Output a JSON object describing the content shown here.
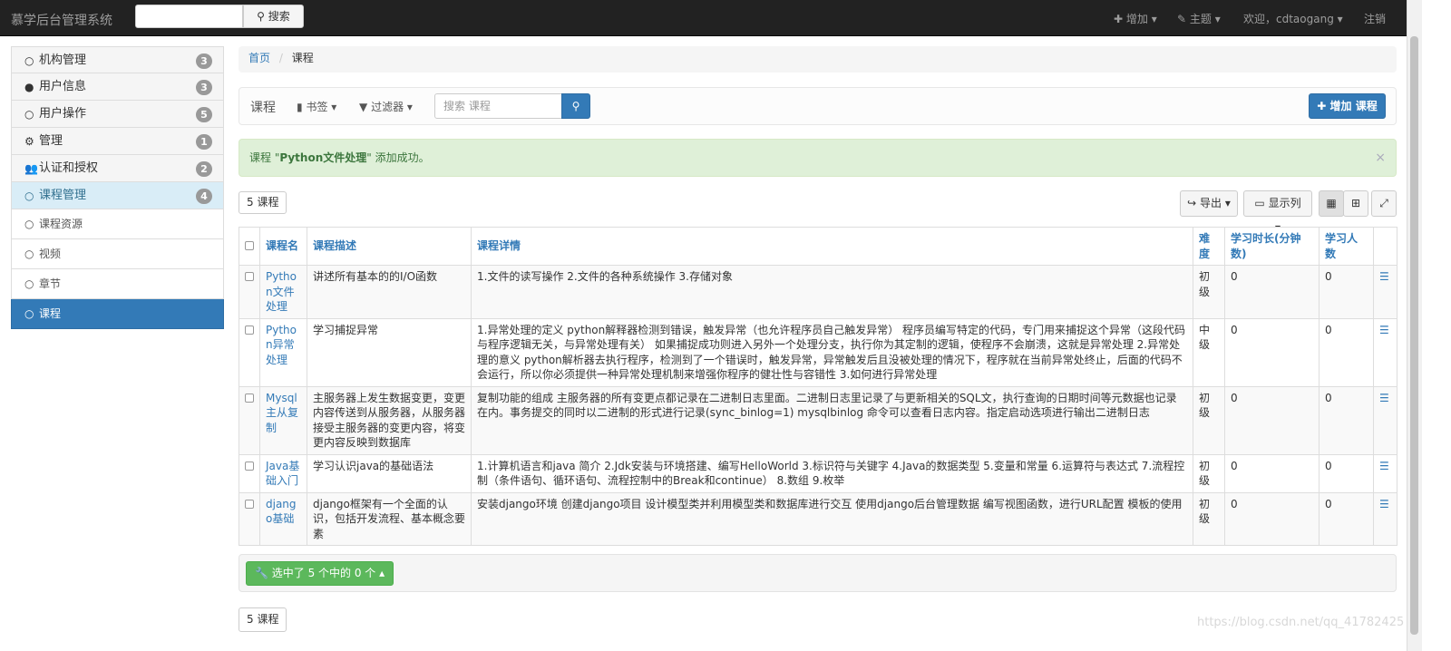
{
  "nav": {
    "brand": "慕学后台管理系统",
    "search_btn": "搜索",
    "add": "增加",
    "theme": "主题",
    "welcome": "欢迎，cdtaogang",
    "logout": "注销"
  },
  "sidebar": {
    "items": [
      {
        "label": "机构管理",
        "badge": "3",
        "icon": "circle-icon"
      },
      {
        "label": "用户信息",
        "badge": "3",
        "icon": "user-icon"
      },
      {
        "label": "用户操作",
        "badge": "5",
        "icon": "circle-icon"
      },
      {
        "label": "管理",
        "badge": "1",
        "icon": "gear-icon"
      },
      {
        "label": "认证和授权",
        "badge": "2",
        "icon": "users-icon"
      },
      {
        "label": "课程管理",
        "badge": "4",
        "icon": "circle-icon"
      }
    ],
    "subitems": [
      {
        "label": "课程资源"
      },
      {
        "label": "视频"
      },
      {
        "label": "章节"
      },
      {
        "label": "课程"
      }
    ]
  },
  "breadcrumb": {
    "home": "首页",
    "sep": "/",
    "current": "课程"
  },
  "toolbar": {
    "title": "课程",
    "bookmarks": "书签",
    "filter": "过滤器",
    "search_placeholder": "搜索 课程",
    "add": "增加 课程"
  },
  "alert": {
    "prefix": "课程 \"",
    "name": "Python文件处理",
    "suffix": "\" 添加成功。",
    "close": "×"
  },
  "count": "5 课程",
  "tools": {
    "export": "导出",
    "columns": "显示列"
  },
  "table": {
    "headers": [
      "课程名",
      "课程描述",
      "课程详情",
      "难度",
      "学习时长(分钟数)",
      "学习人数"
    ],
    "rows": [
      {
        "name": "Python文件处理",
        "desc": "讲述所有基本的的I/O函数",
        "detail": "1.文件的读写操作 2.文件的各种系统操作 3.存储对象",
        "level": "初级",
        "time": "0",
        "students": "0"
      },
      {
        "name": "Python异常处理",
        "desc": "学习捕捉异常",
        "detail": "1.异常处理的定义 python解释器检测到错误，触发异常（也允许程序员自己触发异常） 程序员编写特定的代码，专门用来捕捉这个异常（这段代码与程序逻辑无关，与异常处理有关） 如果捕捉成功则进入另外一个处理分支，执行你为其定制的逻辑，使程序不会崩溃，这就是异常处理 2.异常处理的意义 python解析器去执行程序，检测到了一个错误时，触发异常，异常触发后且没被处理的情况下，程序就在当前异常处终止，后面的代码不会运行，所以你必须提供一种异常处理机制来增强你程序的健壮性与容错性 3.如何进行异常处理",
        "level": "中级",
        "time": "0",
        "students": "0"
      },
      {
        "name": "Mysql主从复制",
        "desc": "主服务器上发生数据变更，变更内容传送到从服务器，从服务器接受主服务器的变更内容，将变更内容反映到数据库",
        "detail": "复制功能的组成 主服务器的所有变更点都记录在二进制日志里面。二进制日志里记录了与更新相关的SQL文，执行查询的日期时间等元数据也记录在内。事务提交的同时以二进制的形式进行记录(sync_binlog=1) mysqlbinlog 命令可以查看日志内容。指定启动选项进行输出二进制日志",
        "level": "初级",
        "time": "0",
        "students": "0"
      },
      {
        "name": "Java基础入门",
        "desc": "学习认识java的基础语法",
        "detail": "1.计算机语言和java 简介 2.Jdk安装与环境搭建、编写HelloWorld 3.标识符与关键字 4.Java的数据类型 5.变量和常量 6.运算符与表达式 7.流程控制（条件语句、循环语句、流程控制中的Break和continue） 8.数组 9.枚举",
        "level": "初级",
        "time": "0",
        "students": "0"
      },
      {
        "name": "django基础",
        "desc": "django框架有一个全面的认识，包括开发流程、基本概念要素",
        "detail": "安装django环境 创建django项目 设计模型类并利用模型类和数据库进行交互 使用django后台管理数据 编写视图函数，进行URL配置 模板的使用",
        "level": "初级",
        "time": "0",
        "students": "0"
      }
    ]
  },
  "footer": {
    "selected": "选中了 5 个中的 0 个",
    "count": "5 课程"
  },
  "watermark": "https://blog.csdn.net/qq_41782425"
}
